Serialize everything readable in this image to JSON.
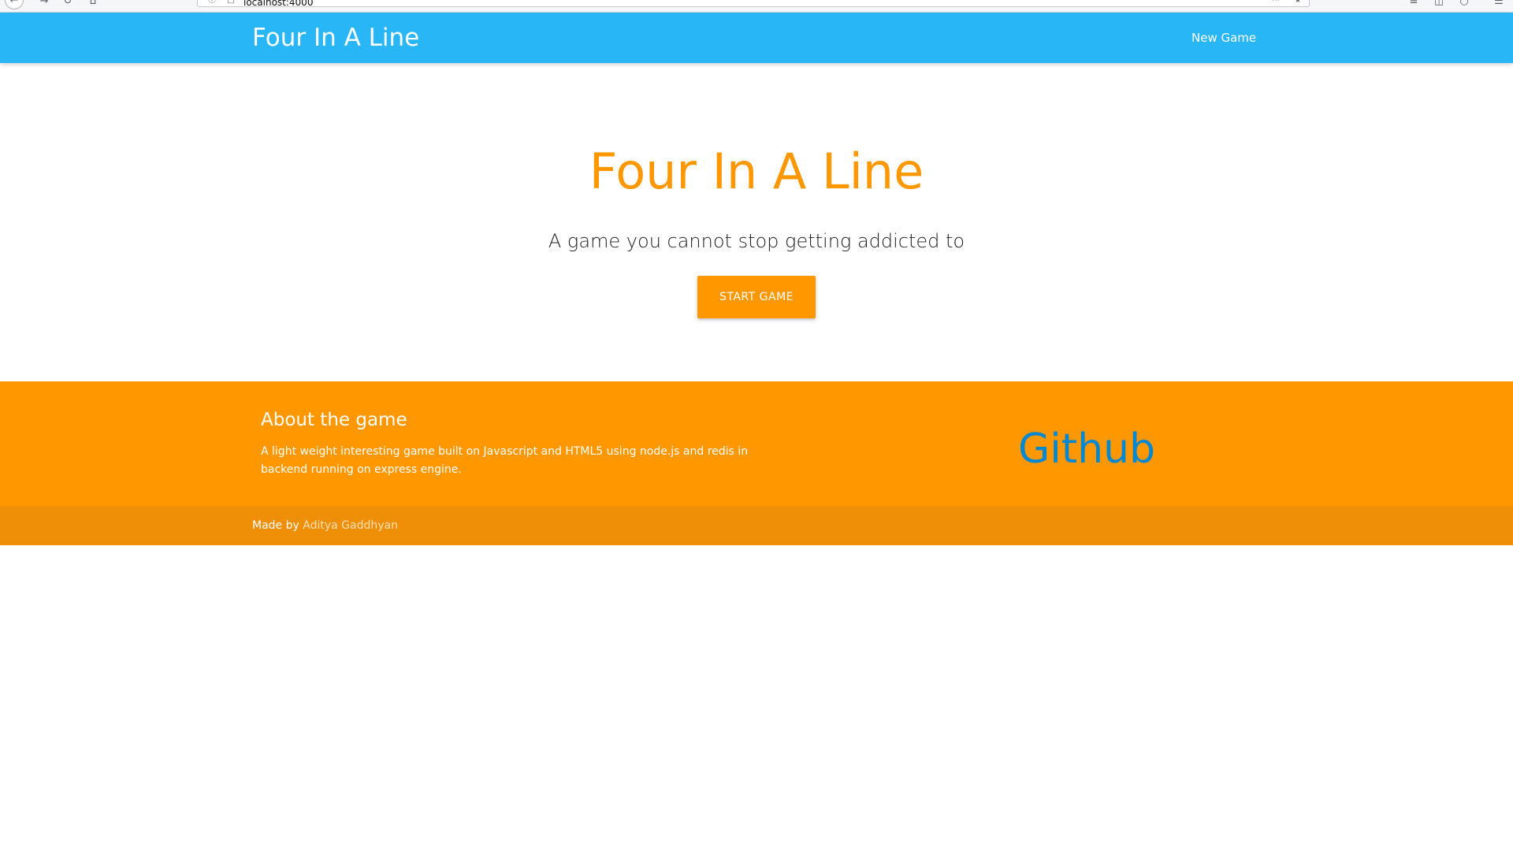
{
  "browser": {
    "url": "localhost:4000",
    "back_icon": "back-arrow-icon",
    "forward_icon": "forward-arrow-icon",
    "reload_icon": "reload-icon",
    "home_icon": "home-icon"
  },
  "navbar": {
    "brand": "Four In A Line",
    "links": [
      {
        "label": "New Game"
      }
    ],
    "color": "#29b6f6"
  },
  "hero": {
    "title": "Four In A Line",
    "subtitle": "A game you cannot stop getting addicted to",
    "button_label": "START GAME",
    "accent_color": "#ff9800"
  },
  "footer": {
    "heading": "About the game",
    "description": "A light weight interesting game built on Javascript and HTML5 using node.js and redis in backend running on express engine.",
    "github_label": "Github",
    "made_by_prefix": "Made by",
    "author": "Aditya Gaddhyan",
    "background_color": "#ff9800",
    "copyright_color": "#ef8f07",
    "github_color": "#0288d1"
  }
}
